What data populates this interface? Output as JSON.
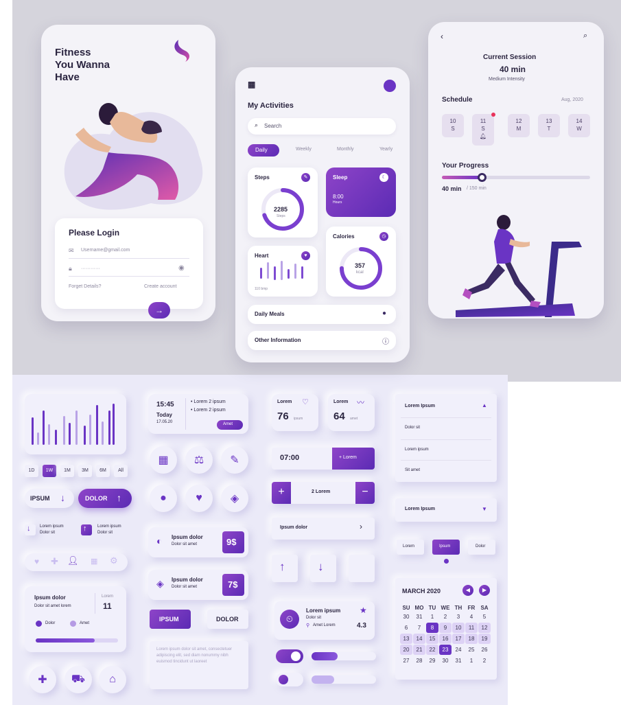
{
  "login_phone": {
    "headline": [
      "Fitness",
      "You Wanna",
      "Have"
    ],
    "title": "Please Login",
    "username": "Username@gmail.com",
    "password": "············",
    "forget": "Forget Details?",
    "create": "Create account",
    "submit_icon": "arrow-right-icon"
  },
  "activities_phone": {
    "title": "My Activities",
    "search_placeholder": "Search",
    "tabs": [
      "Daily",
      "Weekly",
      "Monthly",
      "Yearly"
    ],
    "steps": {
      "label": "Steps",
      "value": "2285",
      "unit": "Steps",
      "progress": 0.7
    },
    "sleep": {
      "label": "Sleep",
      "value": "8:00",
      "unit": "Hours"
    },
    "heart": {
      "label": "Heart",
      "value": "110 bmp"
    },
    "calories": {
      "label": "Calories",
      "value": "357",
      "unit": "kcal",
      "progress": 0.75
    },
    "rows": [
      "Daily Meals",
      "Other Information"
    ]
  },
  "session_phone": {
    "title": "Current Session",
    "duration": "40 min",
    "intensity": "Medium Intensity",
    "schedule_label": "Schedule",
    "schedule_date": "Aug, 2020",
    "days": [
      {
        "num": "10",
        "day": "S"
      },
      {
        "num": "11",
        "day": "S"
      },
      {
        "num": "12",
        "day": "M"
      },
      {
        "num": "13",
        "day": "T"
      },
      {
        "num": "14",
        "day": "W"
      }
    ],
    "progress_label": "Your Progress",
    "progress_value": "40 min",
    "progress_total": "/ 150 min",
    "progress_fraction": 0.27
  },
  "kit": {
    "ranges": [
      "1D",
      "1W",
      "1M",
      "3M",
      "6M",
      "All"
    ],
    "ipsum_btn": "IPSUM",
    "dolor_btn": "DOLOR",
    "mini_items": [
      {
        "line1": "Lorem ipsum",
        "line2": "Dolor sit"
      },
      {
        "line1": "Lorem ipsum",
        "line2": "Dolor sit"
      }
    ],
    "stat_card": {
      "title": "Ipsum dolor",
      "sub": "Dolor sit amet lorem",
      "lorem": "Lorem",
      "value": "11",
      "legend": [
        "Dolor",
        "Amet"
      ],
      "progress": 0.72
    },
    "time_card": {
      "time": "15:45",
      "today": "Today",
      "date": "17.05.20",
      "bullets": [
        "Lorem 2 ipsum",
        "Lorem 2 ipsum"
      ],
      "button": "Amet"
    },
    "price_cards": [
      {
        "title": "Ipsum dolor",
        "sub": "Dolor sit amet",
        "price": "9$"
      },
      {
        "title": "Ipsum dolor",
        "sub": "Dolor sit amet",
        "price": "7$"
      }
    ],
    "ipsum_btn2": "IPSUM",
    "dolor_btn2": "DOLOR",
    "textarea": "Lorem ipsum dolor sit amet, consectetuer adipiscing elit, sed diam nonummy nibh euismod tincidunt ut laoreet",
    "metric_cards": [
      {
        "label": "Lorem",
        "value": "76",
        "unit": "ipsum"
      },
      {
        "label": "Lorem",
        "value": "64",
        "unit": "amet"
      }
    ],
    "time_input": "07:00",
    "time_button": "+ Lorem",
    "stepper_value": "2 Lorem",
    "ipsum_row": "Ipsum dolor",
    "profile_card": {
      "title": "Lorem ipsum",
      "sub": "Dolor sit",
      "location": "Amet Lorem",
      "rating": "4.3"
    },
    "toggle_on": true,
    "slider1": 0.4,
    "slider2": 0.35,
    "dropdown1": {
      "label": "Lorem Ipsum",
      "items": [
        "Dolor sit",
        "Lorem ipsum",
        "Sit amet"
      ]
    },
    "dropdown2": "Lorem Ipsum",
    "segments": [
      "Lorem",
      "Ipsum",
      "Dolor"
    ],
    "calendar": {
      "month": "MARCH 2020",
      "weekdays": [
        "SU",
        "MO",
        "TU",
        "WE",
        "TH",
        "FR",
        "SA"
      ],
      "weeks": [
        [
          "30",
          "31",
          "1",
          "2",
          "3",
          "4",
          "5"
        ],
        [
          "6",
          "7",
          "8",
          "9",
          "10",
          "11",
          "12"
        ],
        [
          "13",
          "14",
          "15",
          "16",
          "17",
          "18",
          "19"
        ],
        [
          "20",
          "21",
          "22",
          "23",
          "24",
          "25",
          "26"
        ],
        [
          "27",
          "28",
          "29",
          "30",
          "31",
          "1",
          "2"
        ]
      ],
      "selected": [
        "8",
        "23"
      ]
    }
  }
}
